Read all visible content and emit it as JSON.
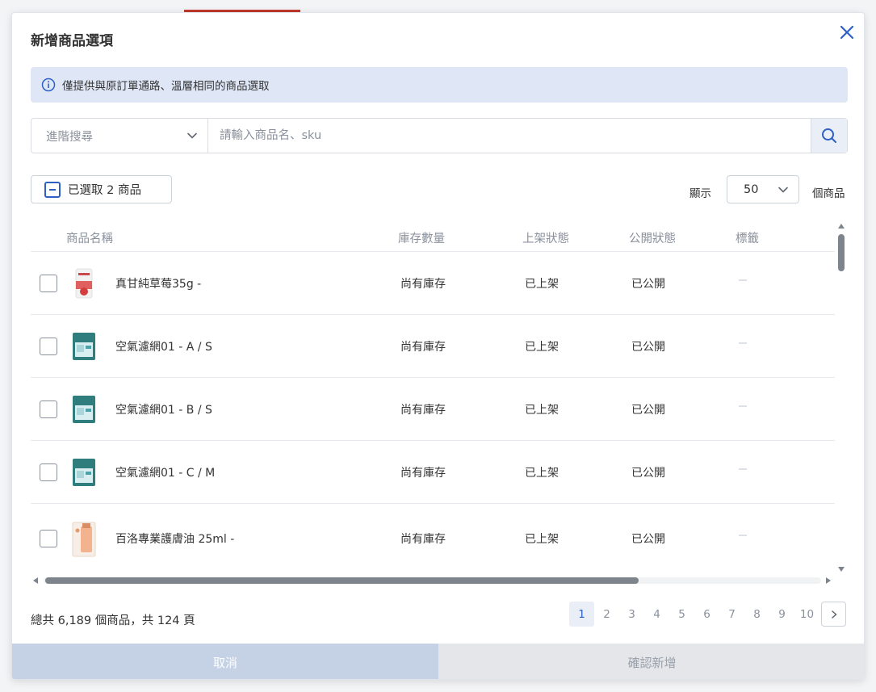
{
  "colors": {
    "accent": "#2d5fc4",
    "notice_bg": "#dfe7f7",
    "cancel_bg": "#c5d1e4",
    "confirm_bg": "#e4e6ea"
  },
  "dialog": {
    "title": "新增商品選項",
    "close_icon": "close-icon",
    "notice": "僅提供與原訂單通路、溫層相同的商品選取"
  },
  "search": {
    "advanced_label": "進階搜尋",
    "placeholder": "請輸入商品名、sku",
    "value": ""
  },
  "toolbar": {
    "selected_label": "已選取 2 商品",
    "show_label": "顯示",
    "per_page": "50",
    "items_label": "個商品"
  },
  "table": {
    "headers": {
      "name": "商品名稱",
      "stock": "庫存數量",
      "shelf": "上架狀態",
      "public": "公開狀態",
      "tags": "標籤"
    },
    "rows": [
      {
        "name": "真甘純草莓35g -",
        "stock": "尚有庫存",
        "shelf": "已上架",
        "public": "已公開",
        "thumb": "strawberry-package",
        "checked": false
      },
      {
        "name": "空氣濾網01 - A / S",
        "stock": "尚有庫存",
        "shelf": "已上架",
        "public": "已公開",
        "thumb": "filter-package",
        "checked": false
      },
      {
        "name": "空氣濾網01 - B / S",
        "stock": "尚有庫存",
        "shelf": "已上架",
        "public": "已公開",
        "thumb": "filter-package",
        "checked": false
      },
      {
        "name": "空氣濾網01 - C / M",
        "stock": "尚有庫存",
        "shelf": "已上架",
        "public": "已公開",
        "thumb": "filter-package",
        "checked": false
      },
      {
        "name": "百洛專業護膚油 25ml -",
        "stock": "尚有庫存",
        "shelf": "已上架",
        "public": "已公開",
        "thumb": "oil-bottle",
        "checked": false
      }
    ]
  },
  "pagination": {
    "total_text": "總共 6,189 個商品，共 124 頁",
    "pages": [
      "1",
      "2",
      "3",
      "4",
      "5",
      "6",
      "7",
      "8",
      "9",
      "10"
    ],
    "current": "1"
  },
  "footer": {
    "cancel_label": "取消",
    "confirm_label": "確認新增"
  }
}
